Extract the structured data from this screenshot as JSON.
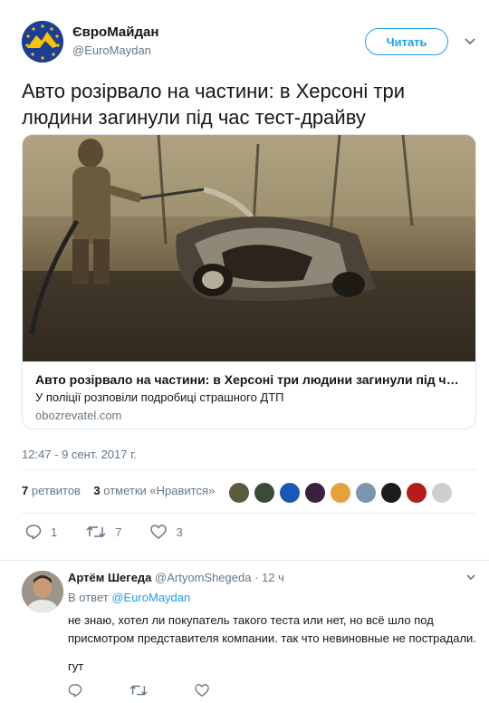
{
  "tweet": {
    "author_name": "ЄвроМайдан",
    "author_handle": "@EuroMaydan",
    "follow_label": "Читать",
    "text": "Авто розірвало на частини: в Херсоні три людини загинули під час тест-драйву",
    "card": {
      "title": "Авто розірвало на частини: в Херсоні три людини загинули під час т...",
      "description": "У поліції розповіли подробиці страшного ДТП",
      "domain": "obozrevatel.com"
    },
    "timestamp": "12:47 - 9 сент. 2017 г.",
    "stats": {
      "retweets_count": "7",
      "retweets_label": "ретвитов",
      "likes_count": "3",
      "likes_label": "отметки «Нравится»"
    },
    "actions": {
      "reply_count": "1",
      "retweet_count": "7",
      "like_count": "3"
    }
  },
  "reply": {
    "author_name": "Артём Шегеда",
    "author_handle": "@ArtyomShegeda",
    "separator": "·",
    "time": "12 ч",
    "reply_to_prefix": "В ответ",
    "reply_to_handle": "@EuroMaydan",
    "text": "не знаю, хотел ли покупатель такого теста или нет, но всё шло под присмотром представителя компании. так что невиновные не пострадали.",
    "extra": "гут"
  },
  "colors": {
    "accent": "#1da1f2",
    "muted": "#657786",
    "text": "#14171a",
    "border": "#e1e8ed"
  },
  "icons": [
    "euromaydan-avatar",
    "chevron-down-icon",
    "reply-icon",
    "retweet-icon",
    "heart-icon"
  ]
}
